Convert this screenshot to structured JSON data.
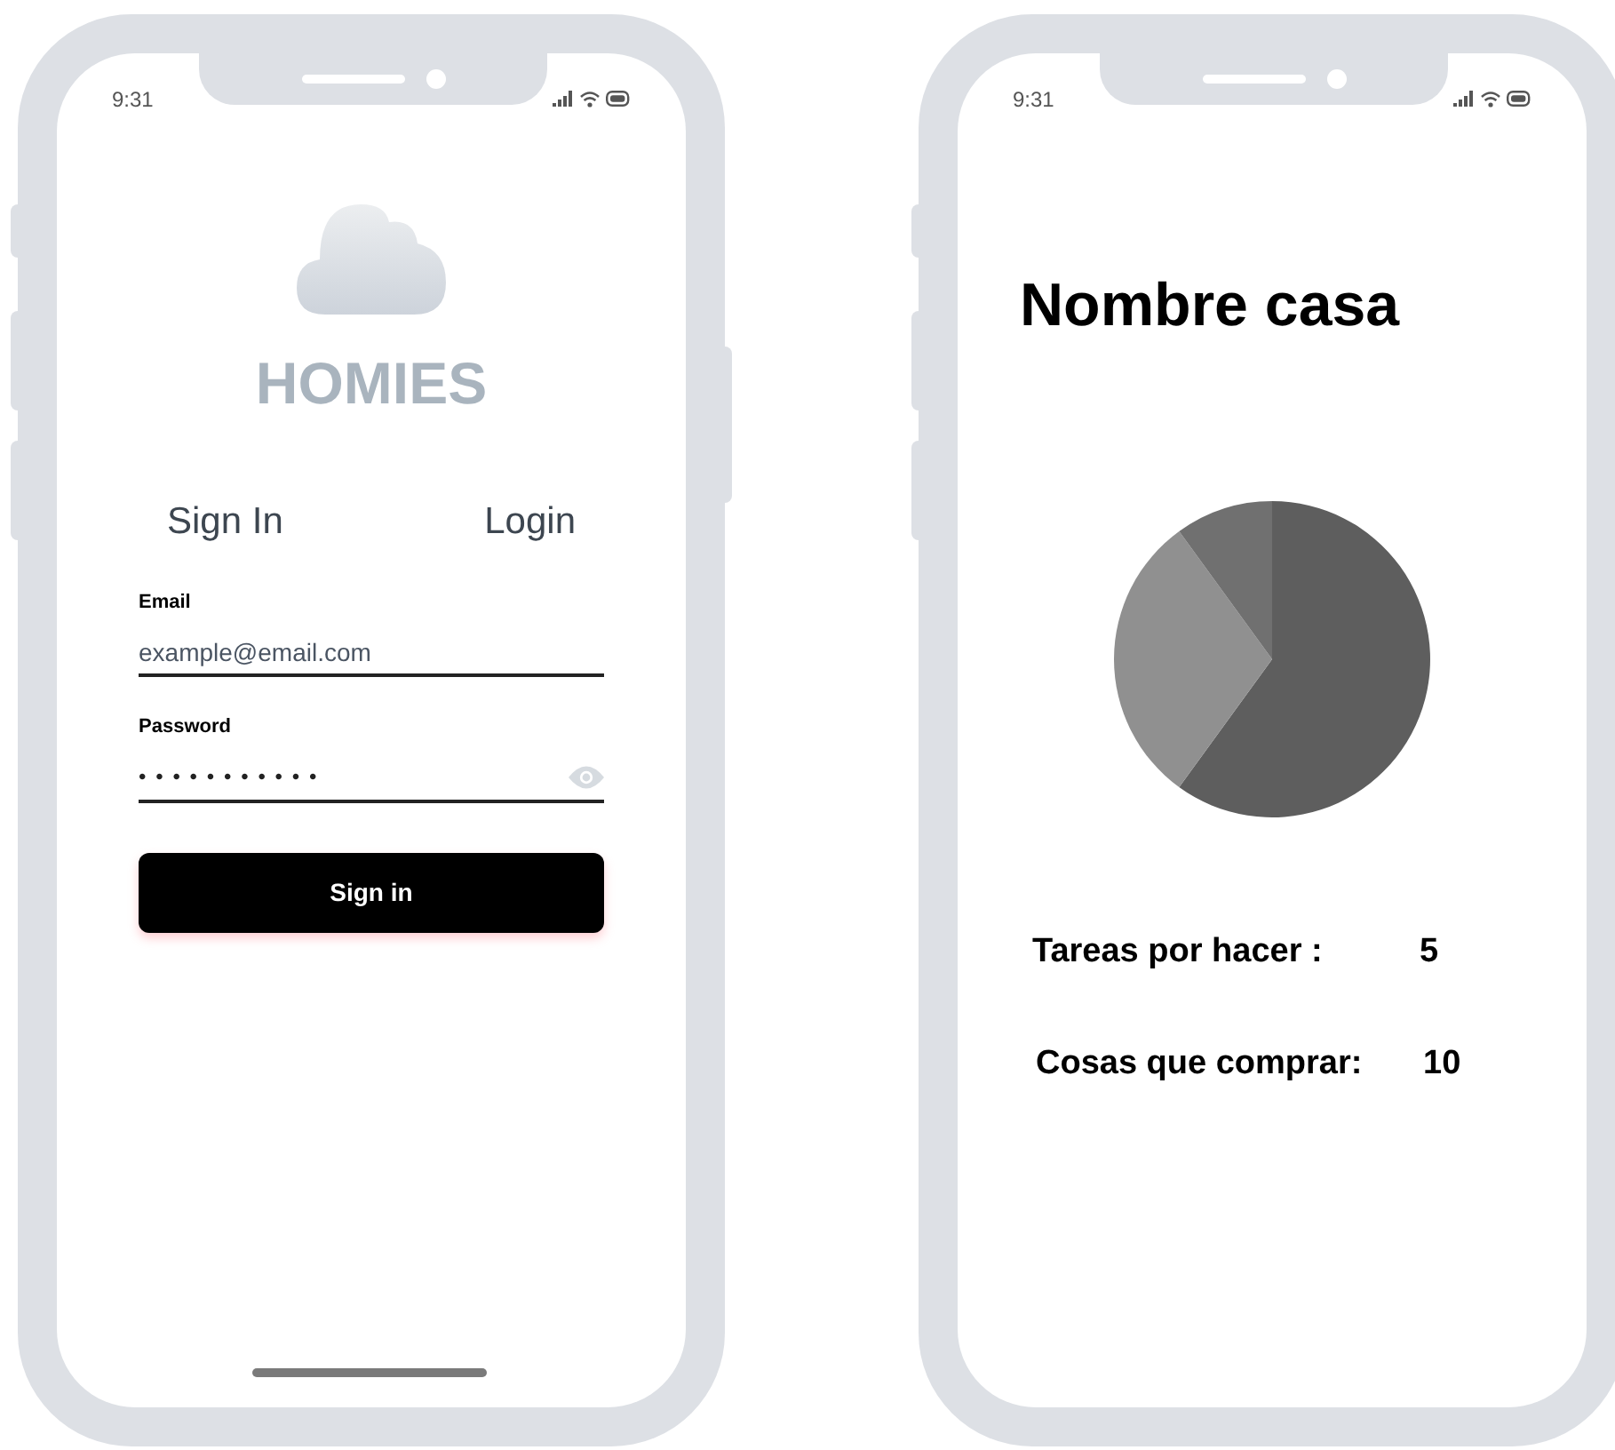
{
  "phones": [
    {
      "kind": "login",
      "status_time": "9:31",
      "app_name": "HOMIES",
      "tabs": [
        {
          "label": "Sign In"
        },
        {
          "label": "Login"
        }
      ],
      "email": {
        "label": "Email",
        "placeholder": "example@email.com"
      },
      "password": {
        "label": "Password",
        "value": "•••••••••••"
      },
      "submit": "Sign in"
    },
    {
      "kind": "dashboard",
      "status_time": "9:31",
      "title": "Nombre casa",
      "stats": [
        {
          "label": "Tareas por hacer :",
          "value": "5"
        },
        {
          "label": "Cosas que comprar:",
          "value": "10"
        }
      ]
    }
  ]
}
